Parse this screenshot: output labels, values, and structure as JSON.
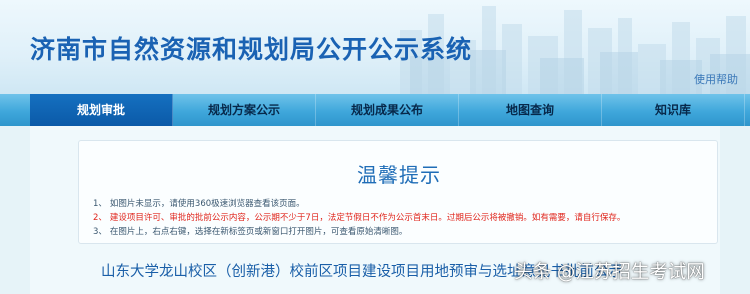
{
  "header": {
    "title": "济南市自然资源和规划局公开公示系统",
    "help_link": "使用帮助"
  },
  "nav": {
    "items": [
      {
        "label": "规划审批",
        "active": true
      },
      {
        "label": "规划方案公示",
        "active": false
      },
      {
        "label": "规划成果公布",
        "active": false
      },
      {
        "label": "地图查询",
        "active": false
      },
      {
        "label": "知识库",
        "active": false
      }
    ]
  },
  "notice": {
    "title": "温馨提示",
    "lines": [
      {
        "num": "1、",
        "text": "如图片未显示，请使用360极速浏览器查看该页面。"
      },
      {
        "num": "2、",
        "text": "建设项目许可、审批的批前公示内容，公示期不少于7日，法定节假日不作为公示首末日。过期后公示将被撤销。如有需要，请自行保存。"
      },
      {
        "num": "3、",
        "text": "在图片上，右点右键，选择在新标签页或新窗口打开图片，可查看原始清晰图。"
      }
    ]
  },
  "project": {
    "title": "山东大学龙山校区（创新港）校前区项目建设项目用地预审与选址意见书批前公示"
  },
  "watermark": "头条 @江苏招生考试网",
  "colors": {
    "title_blue": "#1a62b3",
    "nav_active": "#0b5aa8",
    "notice_red": "#e0261d"
  }
}
